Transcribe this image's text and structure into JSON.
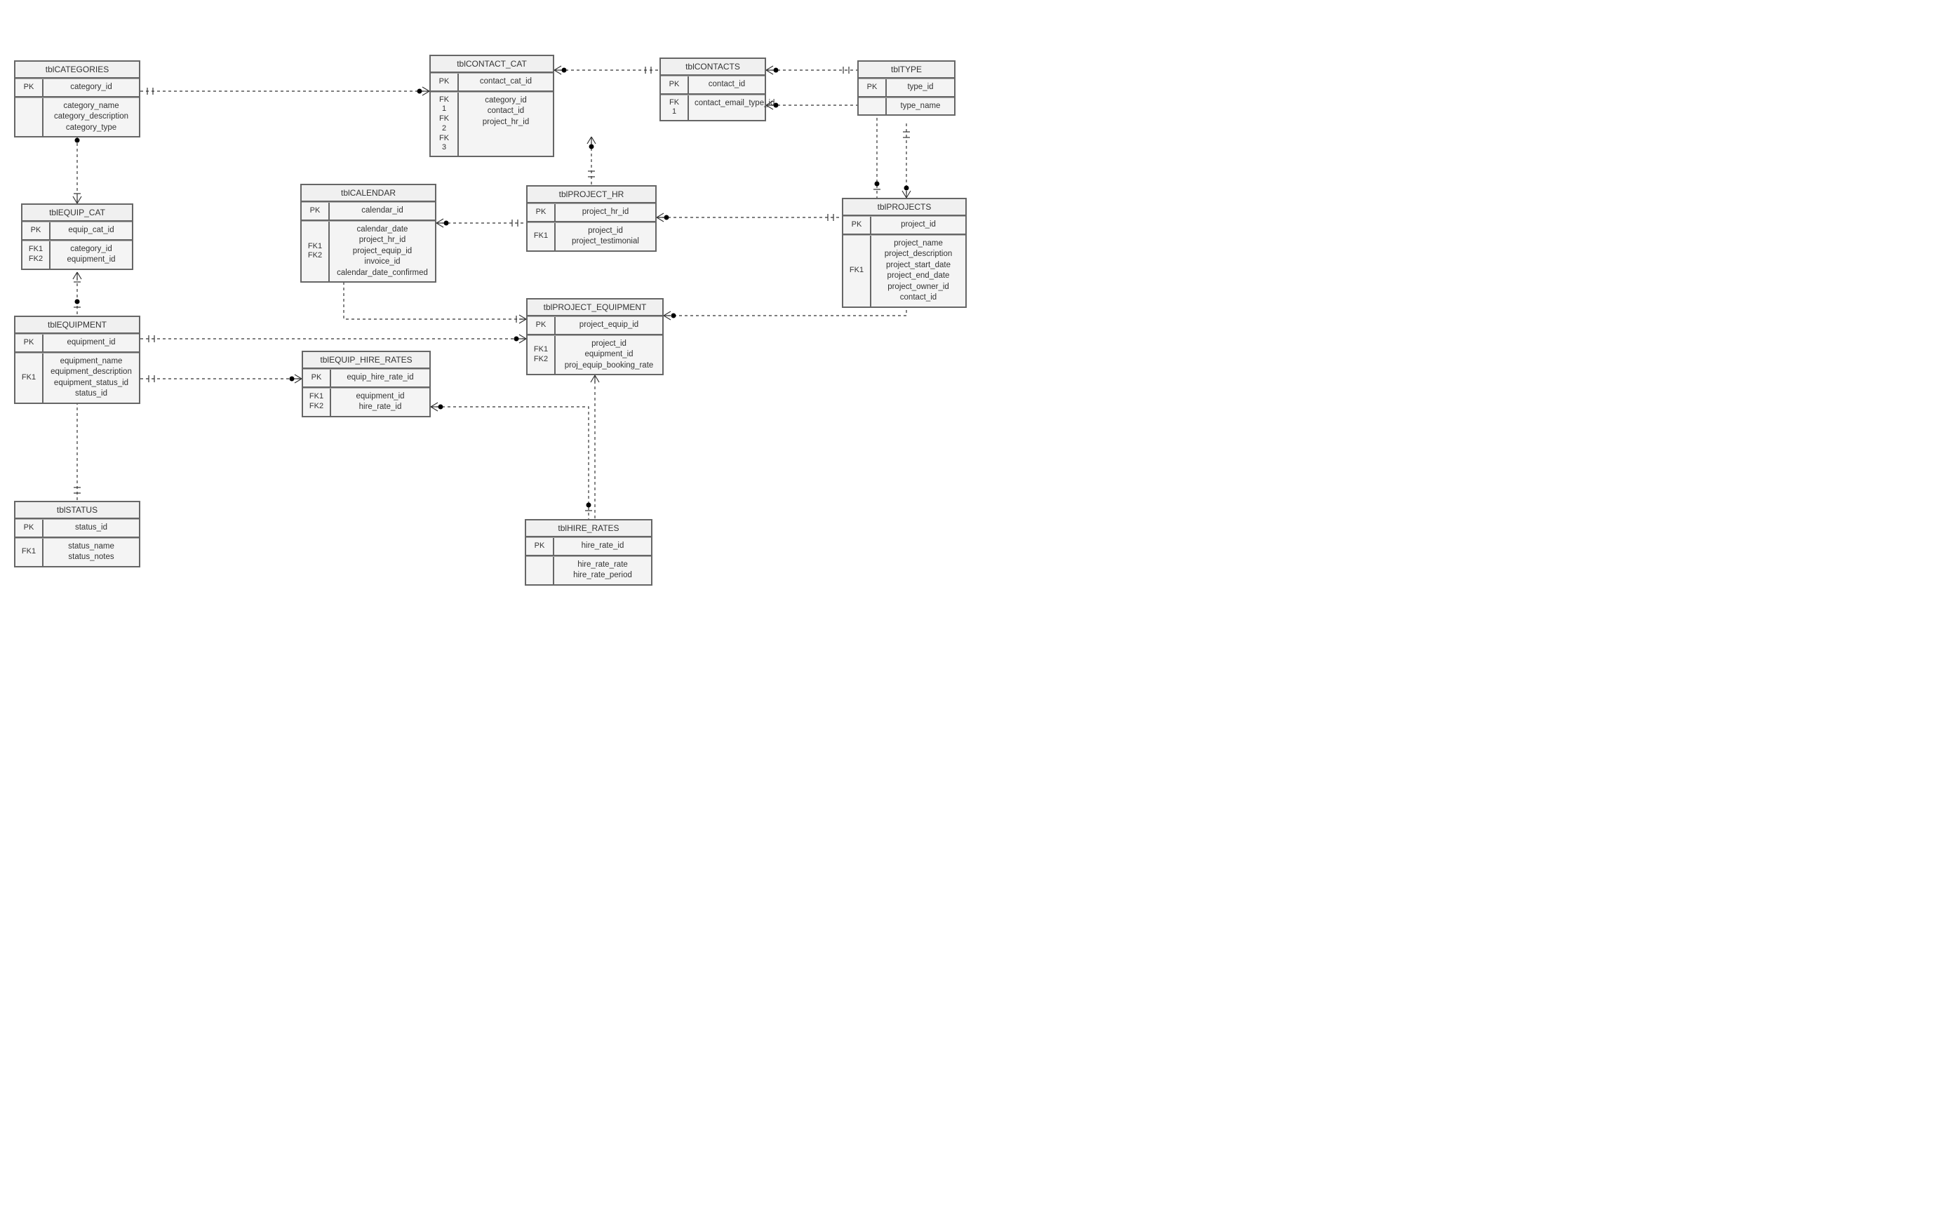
{
  "entities": {
    "categories": {
      "title": "tblCATEGORIES",
      "pk_label": "PK",
      "pk_field": "category_id",
      "attr_key": "",
      "attrs": [
        "category_name",
        "category_description",
        "category_type"
      ]
    },
    "contact_cat": {
      "title": "tblCONTACT_CAT",
      "pk_label": "PK",
      "pk_field": "contact_cat_id",
      "attr_key_lines": [
        "FK",
        "1",
        "FK",
        "2",
        "FK",
        "3"
      ],
      "attrs": [
        "category_id",
        "contact_id",
        "project_hr_id"
      ]
    },
    "contacts": {
      "title": "tblCONTACTS",
      "pk_label": "PK",
      "pk_field": "contact_id",
      "attr_key_lines": [
        "FK",
        "1"
      ],
      "attrs": [
        "contact_email_type_id"
      ]
    },
    "type": {
      "title": "tblTYPE",
      "pk_label": "PK",
      "pk_field": "type_id",
      "attr_key": "",
      "attrs": [
        "type_name"
      ]
    },
    "equip_cat": {
      "title": "tblEQUIP_CAT",
      "pk_label": "PK",
      "pk_field": "equip_cat_id",
      "attr_key_lines": [
        "FK1",
        "FK2"
      ],
      "attrs": [
        "category_id",
        "equipment_id"
      ]
    },
    "calendar": {
      "title": "tblCALENDAR",
      "pk_label": "PK",
      "pk_field": "calendar_id",
      "attr_key_lines": [
        "FK1",
        "FK2"
      ],
      "attrs": [
        "calendar_date",
        "project_hr_id",
        "project_equip_id",
        "invoice_id",
        "calendar_date_confirmed"
      ]
    },
    "project_hr": {
      "title": "tblPROJECT_HR",
      "pk_label": "PK",
      "pk_field": "project_hr_id",
      "attr_key_lines": [
        "FK1"
      ],
      "attrs": [
        "project_id",
        "project_testimonial"
      ]
    },
    "projects": {
      "title": "tblPROJECTS",
      "pk_label": "PK",
      "pk_field": "project_id",
      "attr_key_lines": [
        "FK1"
      ],
      "attrs": [
        "project_name",
        "project_description",
        "project_start_date",
        "project_end_date",
        "project_owner_id",
        "contact_id"
      ]
    },
    "equipment": {
      "title": "tblEQUIPMENT",
      "pk_label": "PK",
      "pk_field": "equipment_id",
      "attr_key_lines": [
        "FK1"
      ],
      "attrs": [
        "equipment_name",
        "equipment_description",
        "equipment_status_id",
        "status_id"
      ]
    },
    "equip_hire_rates": {
      "title": "tblEQUIP_HIRE_RATES",
      "pk_label": "PK",
      "pk_field": "equip_hire_rate_id",
      "attr_key_lines": [
        "FK1",
        "FK2"
      ],
      "attrs": [
        "equipment_id",
        "hire_rate_id"
      ]
    },
    "project_equipment": {
      "title": "tblPROJECT_EQUIPMENT",
      "pk_label": "PK",
      "pk_field": "project_equip_id",
      "attr_key_lines": [
        "FK1",
        "FK2"
      ],
      "attrs": [
        "project_id",
        "equipment_id",
        "proj_equip_booking_rate"
      ]
    },
    "status": {
      "title": "tblSTATUS",
      "pk_label": "PK",
      "pk_field": "status_id",
      "attr_key_lines": [
        "FK1"
      ],
      "attrs": [
        "status_name",
        "status_notes"
      ]
    },
    "hire_rates": {
      "title": "tblHIRE_RATES",
      "pk_label": "PK",
      "pk_field": "hire_rate_id",
      "attr_key": "",
      "attrs": [
        "hire_rate_rate",
        "hire_rate_period"
      ]
    }
  }
}
